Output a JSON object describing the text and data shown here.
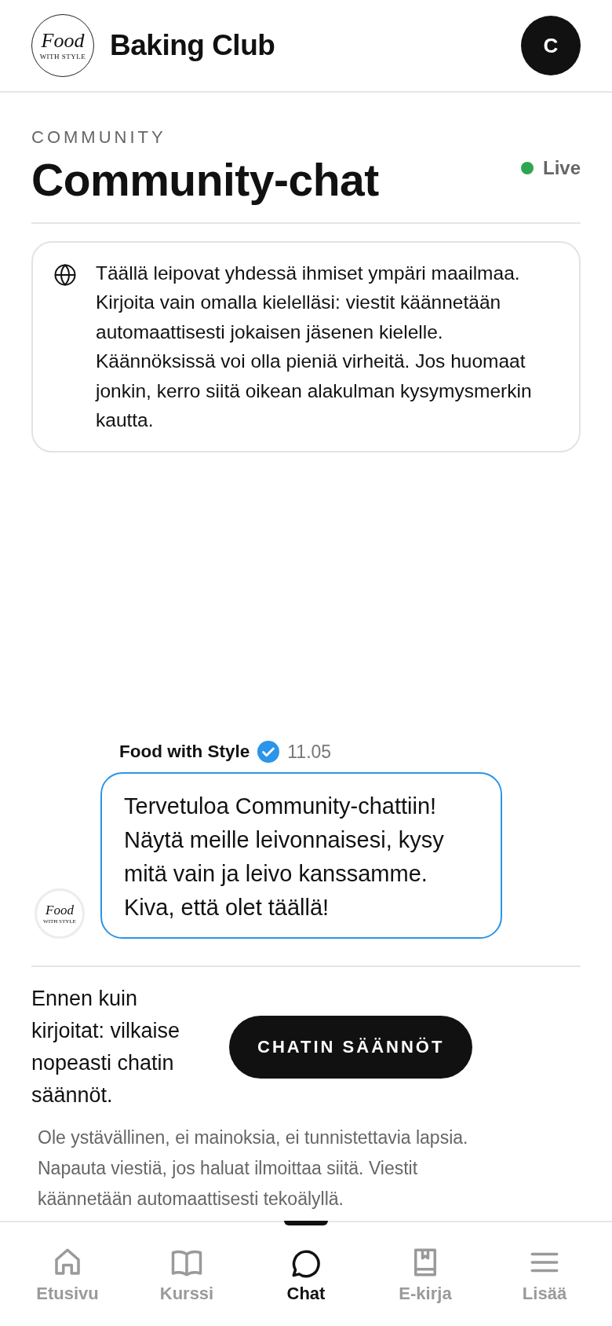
{
  "header": {
    "logo": {
      "script": "Food",
      "tagline": "WITH STYLE"
    },
    "title": "Baking Club",
    "avatar_initial": "C"
  },
  "page": {
    "eyebrow": "COMMUNITY",
    "title": "Community-chat",
    "live": {
      "label": "Live",
      "on": true
    }
  },
  "notice": "Täällä leipovat yhdessä ihmiset ympäri maailmaa. Kirjoita vain omalla kielelläsi: viestit käännetään automaattisesti jokaisen jäsenen kielelle. Käännöksissä voi olla pieniä virheitä. Jos huomaat jonkin, kerro siitä oikean alakulman kysymysmerkin kautta.",
  "messages": [
    {
      "author": "Food with Style",
      "verified": true,
      "time": "11.05",
      "avatar": {
        "script": "Food",
        "tagline": "WITH STYLE"
      },
      "text": "Tervetuloa Community-chattiin! Näytä meille leivonnaisesi, kysy mitä vain ja leivo kanssamme. Kiva, että olet täällä!"
    }
  ],
  "rules": {
    "prompt": "Ennen kuin kirjoitat: vilkaise nopeasti chatin säännöt.",
    "button": "CHATIN SÄÄNNÖT",
    "note": "Ole ystävällinen, ei mainoksia, ei tunnistettavia lapsia. Napauta viestiä, jos haluat ilmoittaa siitä. Viestit käännetään automaattisesti tekoälyllä."
  },
  "nav": [
    {
      "label": "Etusivu",
      "kind": "home",
      "selected": false
    },
    {
      "label": "Kurssi",
      "kind": "book",
      "selected": false
    },
    {
      "label": "Chat",
      "kind": "chat",
      "selected": true
    },
    {
      "label": "E-kirja",
      "kind": "ebook",
      "selected": false
    },
    {
      "label": "Lisää",
      "kind": "menu",
      "selected": false
    }
  ]
}
